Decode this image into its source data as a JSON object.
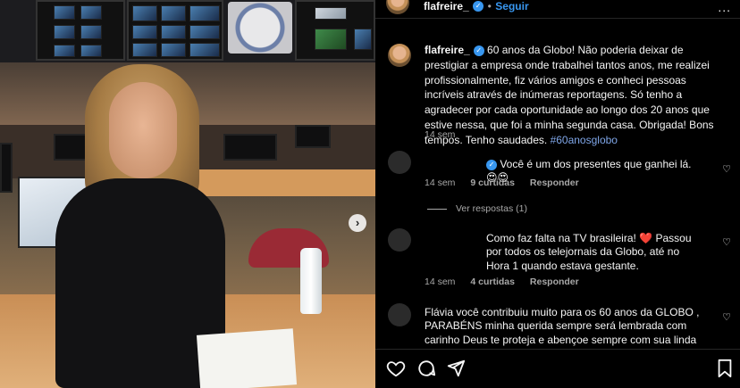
{
  "post": {
    "username": "flafreire_",
    "follow_label": "Seguir",
    "dot": "•",
    "more_label": "...",
    "caption_text": "60 anos da Globo! Não poderia deixar de prestigiar a empresa onde trabalhei tantos anos, me realizei profissionalmente, fiz vários amigos e conheci pessoas incríveis através de inúmeras reportagens. Só tenho a agradecer por cada oportunidade ao longo dos 20 anos que estive nessa, que foi a minha segunda casa. Obrigada! Bons tempos. Tenho saudades.",
    "hashtag": "#60anosglobo",
    "caption_time": "14 sem",
    "verified_mark": "✓"
  },
  "comments": [
    {
      "text": "Você é um dos presentes que ganhei lá. 😍😍",
      "time": "14 sem",
      "likes": "9 curtidas",
      "reply_label": "Responder",
      "view_replies": "Ver respostas (1)"
    },
    {
      "text": "Como faz falta na TV brasileira! ❤️ Passou por todos os telejornais da Globo, até no Hora 1 quando estava gestante.",
      "time": "14 sem",
      "likes": "4 curtidas",
      "reply_label": "Responder"
    },
    {
      "text": "Flávia você contribuiu muito para os 60 anos da GLOBO , PARABÉNS minha querida sempre será lembrada com carinho Deus te proteja e abençoe sempre com sua linda"
    }
  ],
  "carousel": {
    "next_label": "›"
  },
  "icons": {
    "like": "heart-icon",
    "comment": "comment-icon",
    "share": "share-icon",
    "save": "bookmark-icon"
  },
  "colors": {
    "accent": "#3897f0",
    "hashtag": "#7fa6e8",
    "muted": "#a8a8a8",
    "background": "#000000"
  }
}
